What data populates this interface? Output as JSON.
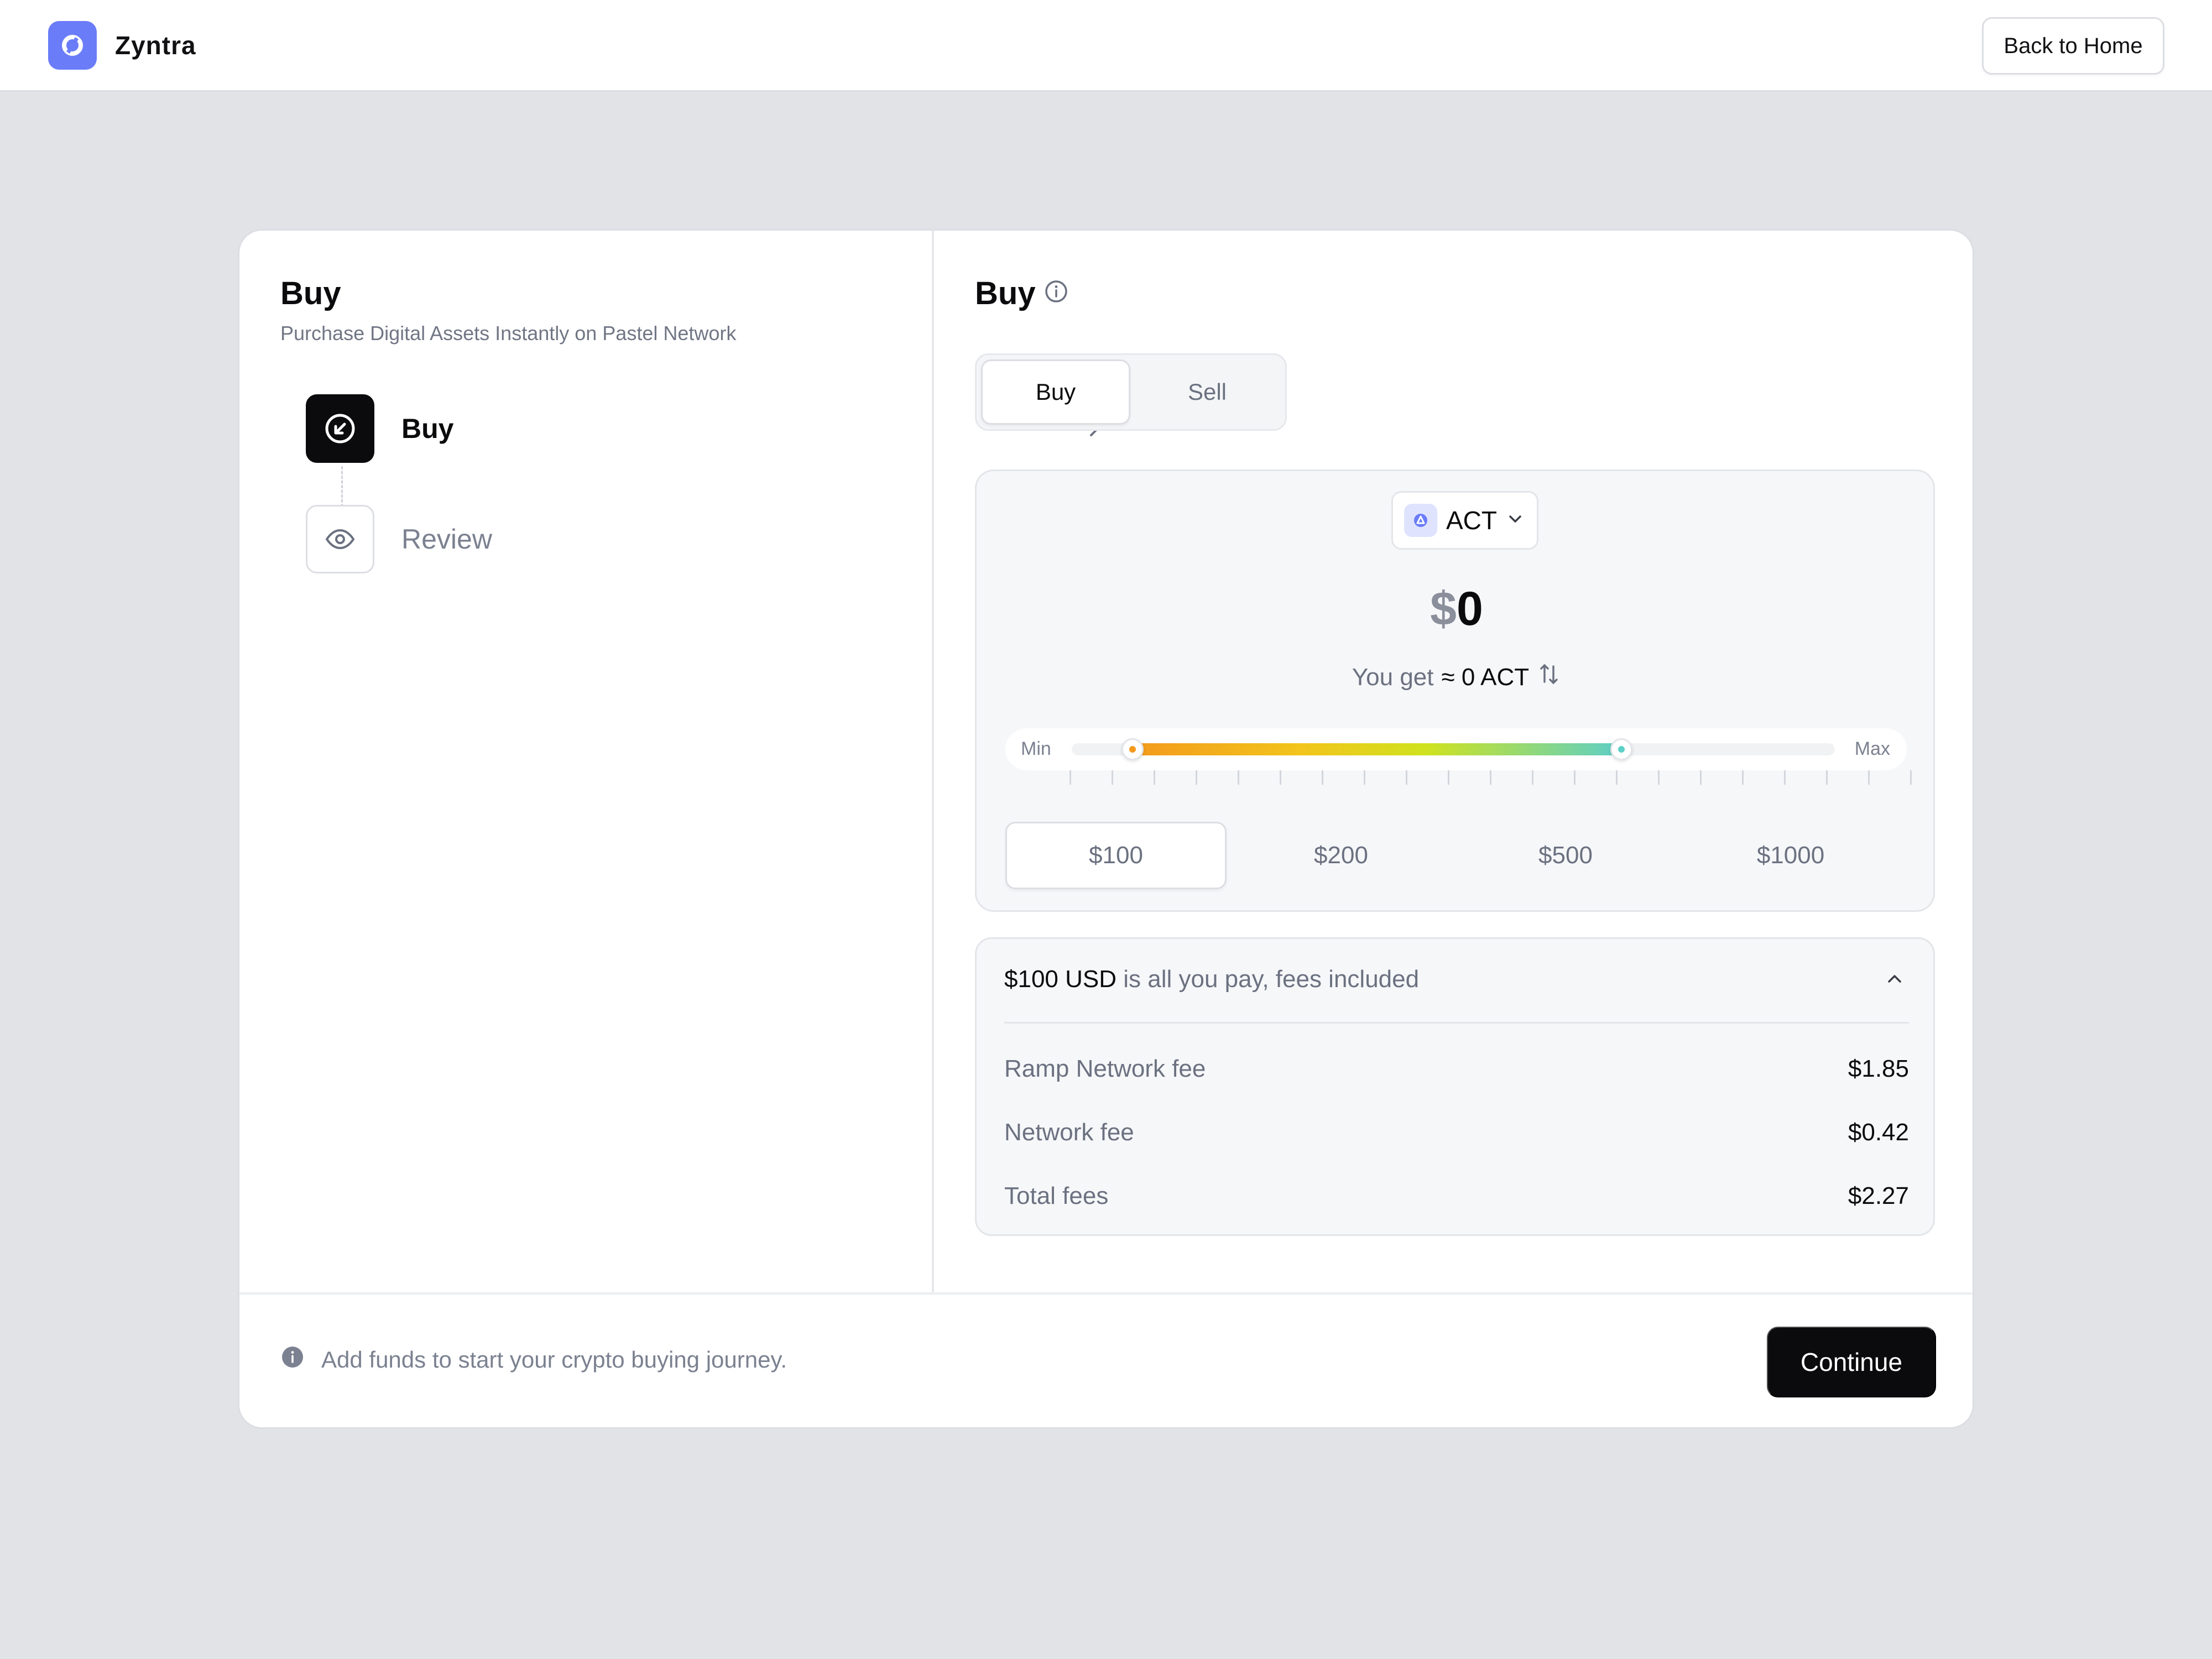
{
  "header": {
    "brand_name": "Zyntra",
    "logo_icon": "brand-logo-icon",
    "back_label": "Back to Home"
  },
  "left_panel": {
    "title": "Buy",
    "subtitle": "Purchase Digital Assets Instantly on Pastel Network",
    "steps": [
      {
        "label": "Buy",
        "icon": "arrow-down-left-circle-icon",
        "active": true
      },
      {
        "label": "Review",
        "icon": "eye-icon",
        "active": false
      }
    ]
  },
  "right_panel": {
    "title": "Buy",
    "info_icon": "info-circle-icon",
    "tabs": [
      {
        "label": "Buy",
        "selected": true
      },
      {
        "label": "Sell",
        "selected": false
      }
    ],
    "asset": {
      "symbol": "ACT",
      "icon": "act-token-icon"
    },
    "amount": {
      "currency_symbol": "$",
      "value": "0"
    },
    "you_get": {
      "label": "You get",
      "value": "≈ 0 ACT"
    },
    "slider": {
      "min_label": "Min",
      "max_label": "Max",
      "low_fraction": 0.08,
      "high_fraction": 0.72
    },
    "presets": [
      {
        "label": "$100",
        "selected": true
      },
      {
        "label": "$200",
        "selected": false
      },
      {
        "label": "$500",
        "selected": false
      },
      {
        "label": "$1000",
        "selected": false
      }
    ],
    "fees": {
      "summary_strong": "$100 USD",
      "summary_rest": "is all you pay, fees included",
      "rows": [
        {
          "name": "Ramp Network fee",
          "value": "$1.85"
        },
        {
          "name": "Network fee",
          "value": "$0.42"
        },
        {
          "name": "Total fees",
          "value": "$2.27"
        }
      ]
    }
  },
  "footer": {
    "info_text": "Add funds to start your crypto buying journey.",
    "continue_label": "Continue"
  },
  "colors": {
    "accent": "#6a7cf8",
    "primary_button": "#0b0b0d",
    "page_background": "#e1e3e7"
  }
}
